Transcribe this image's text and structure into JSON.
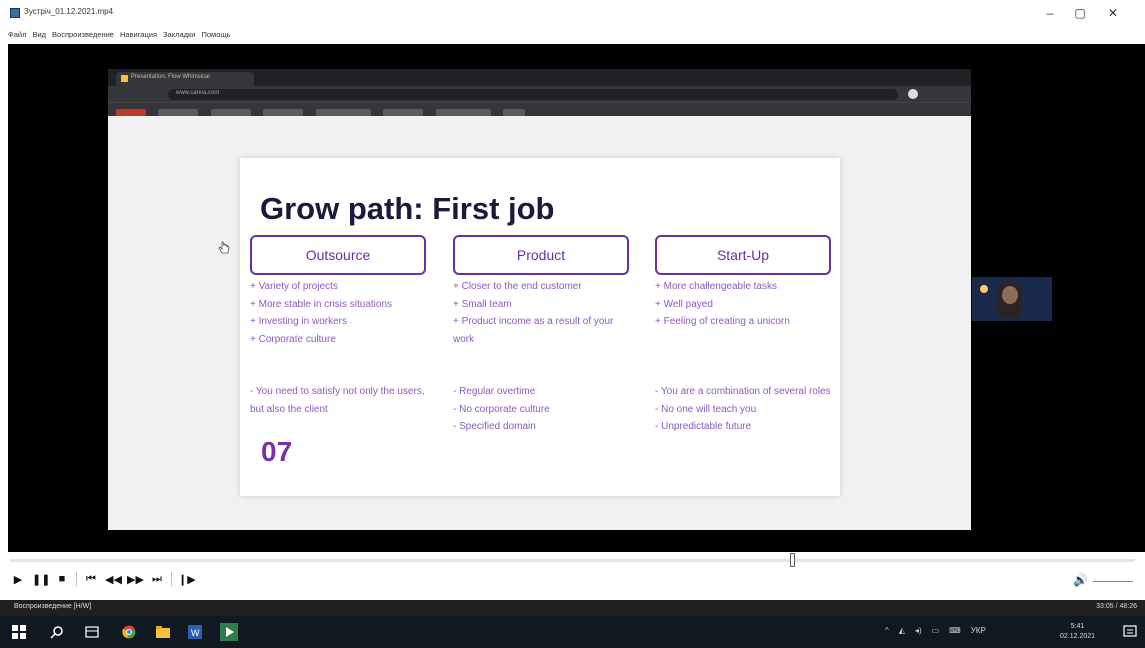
{
  "window": {
    "title": "Зустріч_01.12.2021.mp4"
  },
  "menu": [
    "Файл",
    "Вид",
    "Воспроизведение",
    "Навигация",
    "Закладки",
    "Помощь"
  ],
  "browser": {
    "tab_title": "Presentation: Flow Whimsical",
    "url": "www.canva.com"
  },
  "slide": {
    "title": "Grow path: First job",
    "number": "07",
    "columns": [
      {
        "header": "Outsource",
        "pros": "+ Variety of projects\n+ More stable in crisis situations\n+ Investing in workers\n+ Corporate culture",
        "cons": "- You need to satisfy not only the users, but also the client"
      },
      {
        "header": "Product",
        "pros": "+ Closer to the end customer\n+ Small team\n+ Product income as a result of your work",
        "cons": "- Regular overtime\n- No corporate culture\n- Specified domain"
      },
      {
        "header": "Start-Up",
        "pros": "+ More challengeable tasks\n+ Well payed\n+ Feeling of creating a unicorn",
        "cons": "- You are a combination of several roles\n- No one will teach you\n- Unpredictable future"
      }
    ]
  },
  "player": {
    "status": "Воспроизведение [H/W]",
    "time": "33:05 / 48:26"
  },
  "taskbar": {
    "lang": "УКР",
    "time": "5:41",
    "date": "02.12.2021"
  },
  "colors": {
    "accent": "#6a2fa3",
    "title_dark": "#1a1a3a"
  }
}
